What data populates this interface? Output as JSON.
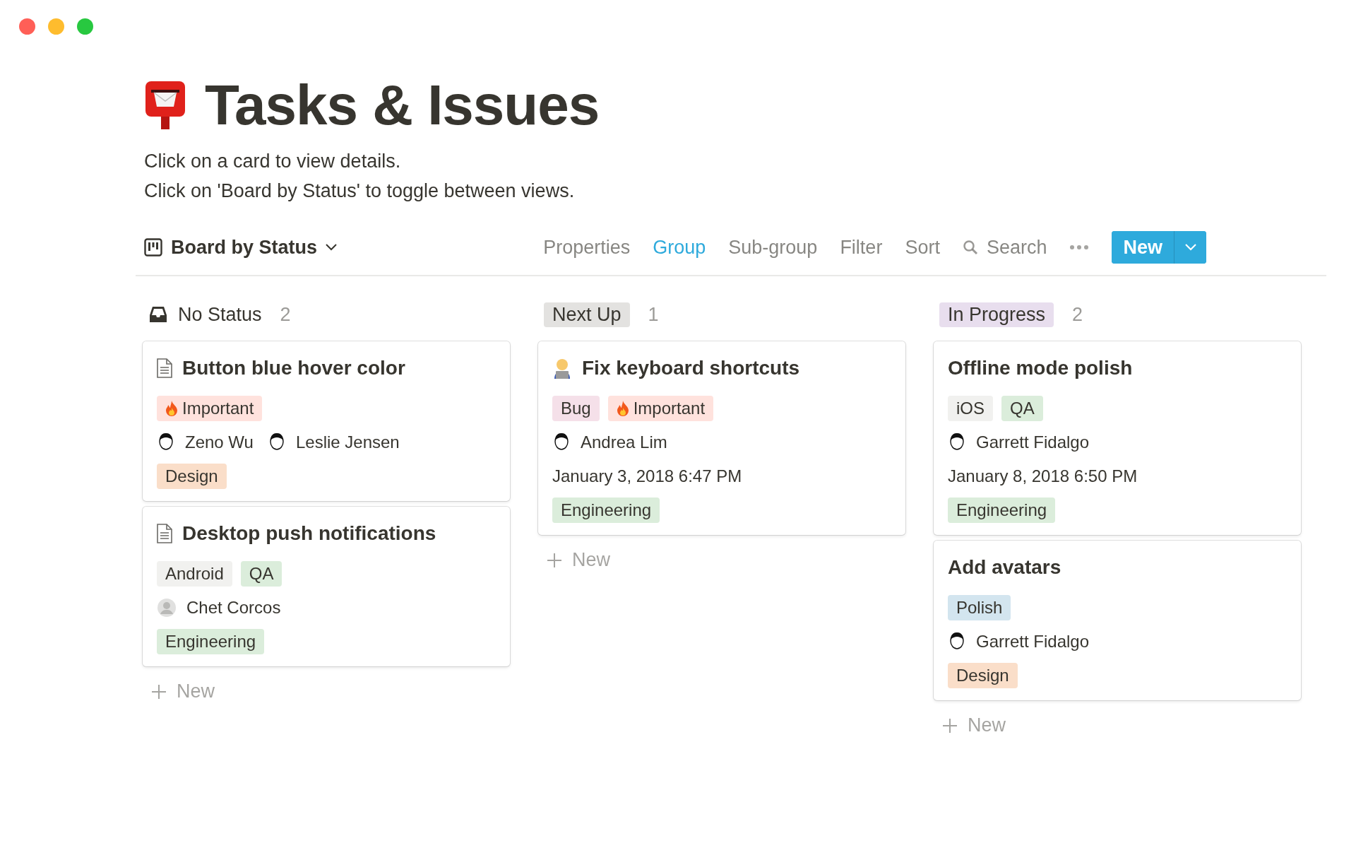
{
  "page": {
    "title": "Tasks & Issues",
    "description": [
      "Click on a card to view details.",
      "Click on 'Board by Status' to toggle between views."
    ]
  },
  "toolbar": {
    "view": {
      "label": "Board by Status"
    },
    "actions": [
      {
        "label": "Properties",
        "active": false
      },
      {
        "label": "Group",
        "active": true
      },
      {
        "label": "Sub-group",
        "active": false
      },
      {
        "label": "Filter",
        "active": false
      },
      {
        "label": "Sort",
        "active": false
      }
    ],
    "search": {
      "label": "Search"
    },
    "new_button": {
      "label": "New"
    }
  },
  "columns": [
    {
      "name": "No Status",
      "count": "2",
      "cards": [
        {
          "title": "Button blue hover color",
          "properties": [
            {
              "kind": "tags",
              "tags": [
                {
                  "label": "Important",
                  "kind": "flagged",
                  "color": "#ffe2dd"
                }
              ]
            },
            {
              "kind": "people",
              "people": [
                {
                  "name": "Zeno Wu",
                  "kind": "drawn"
                },
                {
                  "name": "Leslie Jensen",
                  "kind": "drawn"
                }
              ]
            },
            {
              "kind": "tags",
              "tags": [
                {
                  "label": "Design",
                  "kind": "plain",
                  "color": "#fadec9"
                }
              ]
            }
          ]
        },
        {
          "title": "Desktop push notifications",
          "properties": [
            {
              "kind": "tags",
              "tags": [
                {
                  "label": "Android",
                  "kind": "plain",
                  "color": "#f1f1ef"
                },
                {
                  "label": "QA",
                  "kind": "plain",
                  "color": "#dbeddb"
                }
              ]
            },
            {
              "kind": "people",
              "people": [
                {
                  "name": "Chet Corcos",
                  "kind": "placeholder"
                }
              ]
            },
            {
              "kind": "tags",
              "tags": [
                {
                  "label": "Engineering",
                  "kind": "plain",
                  "color": "#dbeddb"
                }
              ]
            }
          ]
        }
      ],
      "new_label": "New"
    },
    {
      "name": "Next Up",
      "count": "1",
      "color": "#e3e2e0",
      "cards": [
        {
          "title": "Fix keyboard shortcuts",
          "properties": [
            {
              "kind": "tags",
              "tags": [
                {
                  "label": "Bug",
                  "kind": "plain",
                  "color": "#f5e0e9"
                },
                {
                  "label": "Important",
                  "kind": "flagged",
                  "color": "#ffe2dd"
                }
              ]
            },
            {
              "kind": "people",
              "people": [
                {
                  "name": "Andrea Lim",
                  "kind": "drawn"
                }
              ]
            },
            {
              "kind": "date",
              "text": "January 3, 2018 6:47 PM"
            },
            {
              "kind": "tags",
              "tags": [
                {
                  "label": "Engineering",
                  "kind": "plain",
                  "color": "#dbeddb"
                }
              ]
            }
          ]
        }
      ],
      "new_label": "New"
    },
    {
      "name": "In Progress",
      "count": "2",
      "color": "#e8deee",
      "cards": [
        {
          "title": "Offline mode polish",
          "properties": [
            {
              "kind": "tags",
              "tags": [
                {
                  "label": "iOS",
                  "kind": "plain",
                  "color": "#f1f1ef"
                },
                {
                  "label": "QA",
                  "kind": "plain",
                  "color": "#dbeddb"
                }
              ]
            },
            {
              "kind": "people",
              "people": [
                {
                  "name": "Garrett Fidalgo",
                  "kind": "drawn"
                }
              ]
            },
            {
              "kind": "date",
              "text": "January 8, 2018 6:50 PM"
            },
            {
              "kind": "tags",
              "tags": [
                {
                  "label": "Engineering",
                  "kind": "plain",
                  "color": "#dbeddb"
                }
              ]
            }
          ]
        },
        {
          "title": "Add avatars",
          "properties": [
            {
              "kind": "tags",
              "tags": [
                {
                  "label": "Polish",
                  "kind": "plain",
                  "color": "#d3e5ef"
                }
              ]
            },
            {
              "kind": "people",
              "people": [
                {
                  "name": "Garrett Fidalgo",
                  "kind": "drawn"
                }
              ]
            },
            {
              "kind": "tags",
              "tags": [
                {
                  "label": "Design",
                  "kind": "plain",
                  "color": "#fadec9"
                }
              ]
            }
          ]
        }
      ],
      "new_label": "New"
    }
  ]
}
